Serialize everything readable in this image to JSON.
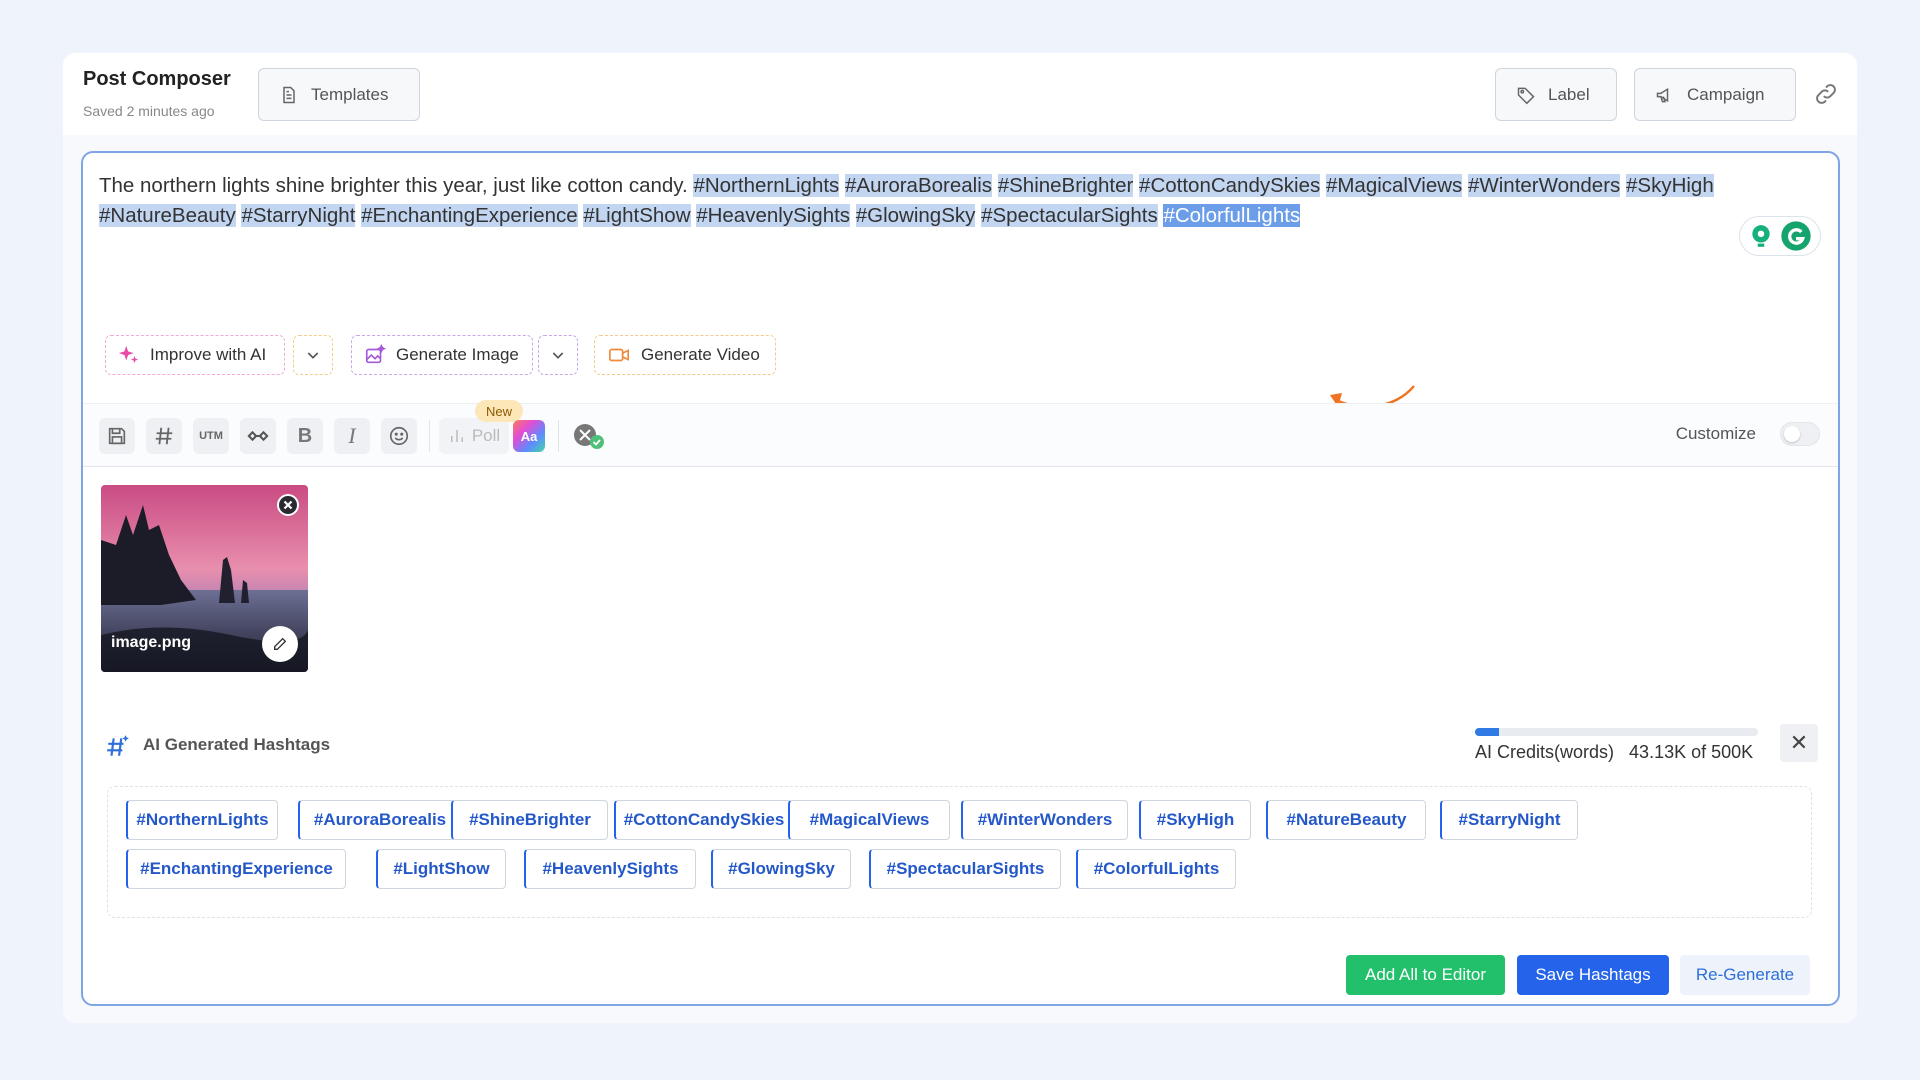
{
  "header": {
    "title": "Post Composer",
    "saved": "Saved 2 minutes ago",
    "templates_label": "Templates",
    "label_label": "Label",
    "campaign_label": "Campaign"
  },
  "editor": {
    "plain_text": "The northern lights shine brighter this year, just like cotton candy.",
    "hashtags": [
      "#NorthernLights",
      "#AuroraBorealis",
      "#ShineBrighter",
      "#CottonCandySkies",
      "#MagicalViews",
      "#WinterWonders",
      "#SkyHigh",
      "#NatureBeauty",
      "#StarryNight",
      "#EnchantingExperience",
      "#LightShow",
      "#HeavenlySights",
      "#GlowingSky",
      "#SpectacularSights",
      "#ColorfulLights"
    ]
  },
  "ai_actions": {
    "improve": "Improve with AI",
    "generate_image": "Generate Image",
    "generate_video": "Generate Video"
  },
  "toolbar": {
    "utm": "UTM",
    "bold": "B",
    "italic": "I",
    "poll": "Poll",
    "new_badge": "New",
    "aa": "Aa",
    "customize": "Customize"
  },
  "media": {
    "filename": "image.png"
  },
  "hashtags_panel": {
    "title": "AI Generated Hashtags",
    "credits_label": "AI Credits(words)",
    "credits_value": "43.13K of 500K",
    "credits_fraction": 0.086,
    "chips": [
      "#NorthernLights",
      "#AuroraBorealis",
      "#ShineBrighter",
      "#CottonCandySkies",
      "#MagicalViews",
      "#WinterWonders",
      "#SkyHigh",
      "#NatureBeauty",
      "#StarryNight",
      "#EnchantingExperience",
      "#LightShow",
      "#HeavenlySights",
      "#GlowingSky",
      "#SpectacularSights",
      "#ColorfulLights"
    ],
    "add_all": "Add All to Editor",
    "save": "Save Hashtags",
    "regenerate": "Re-Generate"
  },
  "colors": {
    "accent": "#2563eb",
    "green": "#22c06b",
    "highlight": "#c2d6f2",
    "selected": "#6b9de8"
  }
}
